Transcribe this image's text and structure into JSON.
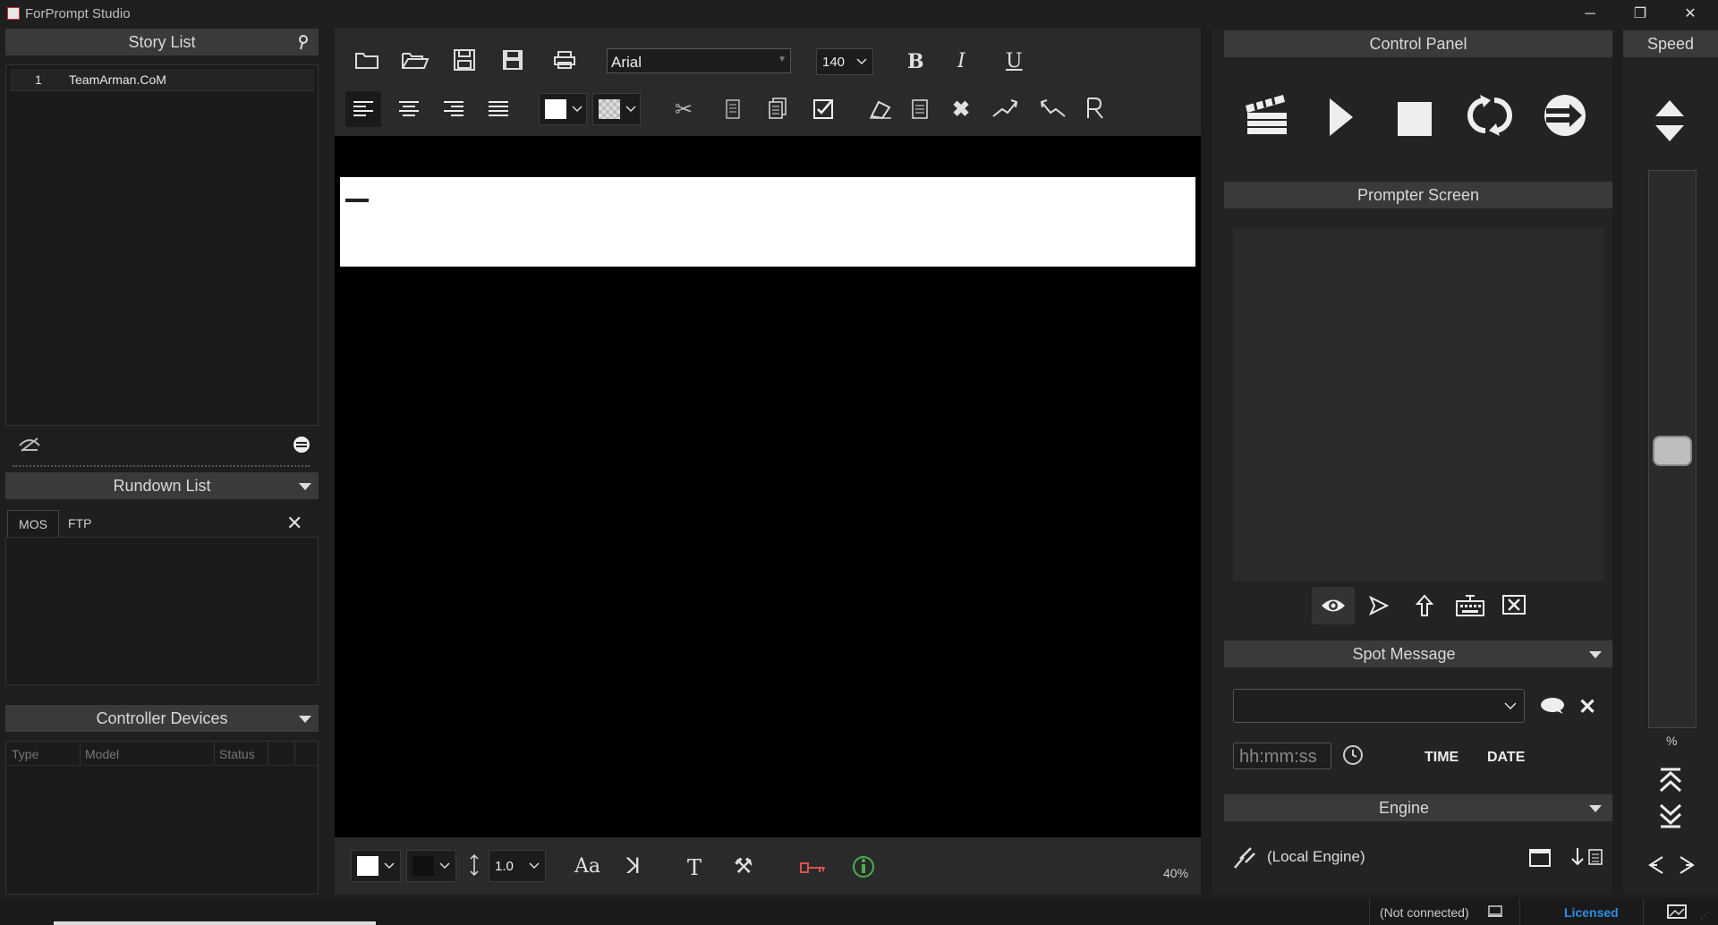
{
  "app": {
    "title": "ForPrompt Studio"
  },
  "window": {
    "minimize": "─",
    "maximize": "❐",
    "close": "✕"
  },
  "story_list": {
    "header": "Story List",
    "rows": [
      {
        "num": "1",
        "name": "TeamArman.CoM"
      }
    ]
  },
  "rundown": {
    "header": "Rundown List",
    "tabs": [
      "MOS",
      "FTP"
    ]
  },
  "controller": {
    "header": "Controller Devices",
    "columns": [
      "Type",
      "Model",
      "Status"
    ]
  },
  "editor": {
    "font": "Arial",
    "font_size": "140",
    "line_spacing": "1.0",
    "zoom": "40%"
  },
  "control_panel": {
    "header": "Control Panel"
  },
  "prompter": {
    "header": "Prompter Screen"
  },
  "spot": {
    "header": "Spot Message",
    "time_placeholder": "hh:mm:ss",
    "time_label": "TIME",
    "date_label": "DATE"
  },
  "engine": {
    "header": "Engine",
    "label": "(Local Engine)"
  },
  "speed": {
    "header": "Speed",
    "percent": "%"
  },
  "status": {
    "connection": "(Not connected)",
    "license": "Licensed"
  },
  "colors": {
    "accent_license": "#2e8fe8",
    "key_icon": "#d9534f",
    "info_icon": "#4caf50"
  }
}
